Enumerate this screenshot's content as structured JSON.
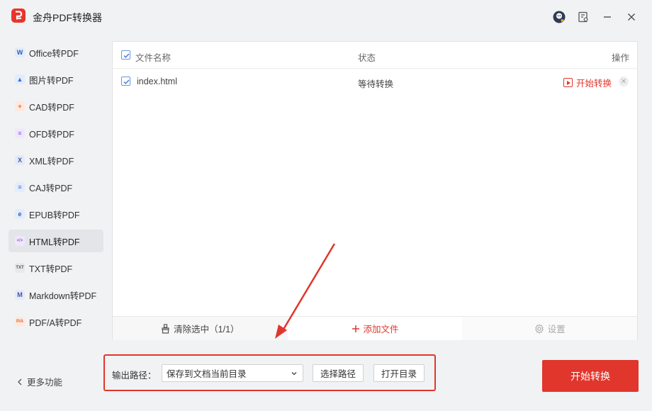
{
  "app": {
    "title": "金舟PDF转换器"
  },
  "titlebar": {
    "icons": [
      "user-avatar-icon",
      "feedback-icon",
      "minimize-icon",
      "close-icon"
    ]
  },
  "sidebar": {
    "items": [
      {
        "label": "Office转PDF",
        "icon": "W",
        "icon_color": "#2b5fb8",
        "icon_bg": "#e3ecfa"
      },
      {
        "label": "图片转PDF",
        "icon": "img",
        "icon_color": "#3a6fd0",
        "icon_bg": "#e3ecfa"
      },
      {
        "label": "CAD转PDF",
        "icon": "+",
        "icon_color": "#e0642c",
        "icon_bg": "#fde9df"
      },
      {
        "label": "OFD转PDF",
        "icon": "≡",
        "icon_color": "#8b5bd6",
        "icon_bg": "#efe7fb"
      },
      {
        "label": "XML转PDF",
        "icon": "X",
        "icon_color": "#3a56a8",
        "icon_bg": "#e6eaf6"
      },
      {
        "label": "CAJ转PDF",
        "icon": "≡",
        "icon_color": "#3a6fd0",
        "icon_bg": "#e3ecfa"
      },
      {
        "label": "EPUB转PDF",
        "icon": "e",
        "icon_color": "#2b5fb8",
        "icon_bg": "#e3ecfa"
      },
      {
        "label": "HTML转PDF",
        "icon": "</>",
        "icon_color": "#8b5bd6",
        "icon_bg": "#efe7fb"
      },
      {
        "label": "TXT转PDF",
        "icon": "TXT",
        "icon_color": "#555",
        "icon_bg": "#e9e9ea"
      },
      {
        "label": "Markdown转PDF",
        "icon": "M",
        "icon_color": "#3a56a8",
        "icon_bg": "#e6eaf6"
      },
      {
        "label": "PDF/A转PDF",
        "icon": "P/A",
        "icon_color": "#e0642c",
        "icon_bg": "#fde9df"
      }
    ],
    "active_index": 7,
    "more_label": "更多功能"
  },
  "table": {
    "headers": {
      "name": "文件名称",
      "status": "状态",
      "action": "操作"
    },
    "rows": [
      {
        "name": "index.html",
        "status": "等待转换",
        "action": "开始转换",
        "checked": true
      }
    ],
    "all_checked": true
  },
  "bottom_bar": {
    "clear_label": "清除选中（1/1）",
    "add_label": "添加文件",
    "settings_label": "设置"
  },
  "output": {
    "label": "输出路径：",
    "selected": "保存到文档当前目录",
    "choose_label": "选择路径",
    "open_label": "打开目录"
  },
  "convert_label": "开始转换",
  "colors": {
    "accent": "#e0362c",
    "checkbox": "#6b95d8"
  }
}
